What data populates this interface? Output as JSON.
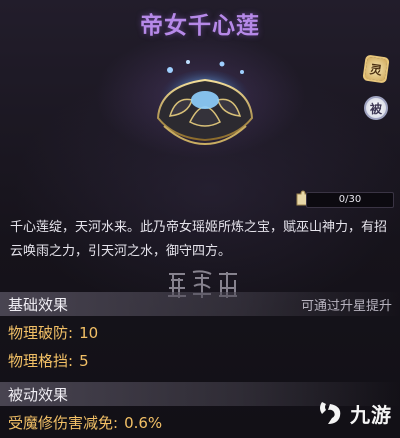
{
  "title": "帝女千心莲",
  "side_badges": {
    "badge_a": "灵",
    "badge_b": "被"
  },
  "fragments": {
    "text": "0/30",
    "progress": 0
  },
  "description": "千心莲绽，天河水来。此乃帝女瑶姬所炼之宝，赋巫山神力，有招云唤雨之力，引天河之水，御守四方。",
  "basic": {
    "title": "基础效果",
    "hint": "可通过升星提升",
    "stats": [
      {
        "name": "物理破防:",
        "value": "10"
      },
      {
        "name": "物理格挡:",
        "value": "5"
      }
    ]
  },
  "passive": {
    "title": "被动效果",
    "stats": [
      {
        "name": "受魔修伤害减免:",
        "value": "0.6%"
      }
    ]
  },
  "watermark": {
    "text": "九游",
    "icon": "jiuyou-logo-icon"
  },
  "colors": {
    "title": "#b689e8",
    "stat": "#f2c066",
    "accent": "#7a62a8"
  }
}
